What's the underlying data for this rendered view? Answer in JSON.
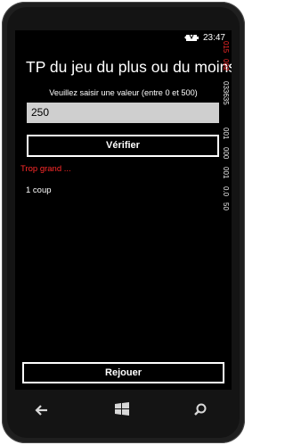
{
  "status_bar": {
    "time": "23:47",
    "icon": "battery-icon"
  },
  "app": {
    "title": "TP du jeu du plus ou du moins",
    "prompt": "Veuillez saisir une valeur (entre 0 et 500)",
    "input_value": "250",
    "verify_label": "Vérifier",
    "result_text": "Trop grand ...",
    "attempts_text": "1 coup",
    "replay_label": "Rejouer"
  },
  "debug_counters": [
    {
      "text": "015",
      "color": "#ff2a2a"
    },
    {
      "text": "002",
      "color": "#ff2a2a"
    },
    {
      "text": "033635",
      "color": "#f0f0f0"
    },
    {
      "text": "001",
      "color": "#f0f0f0"
    },
    {
      "text": "000",
      "color": "#f0f0f0"
    },
    {
      "text": "001",
      "color": "#f0f0f0"
    },
    {
      "text": "0.0",
      "color": "#f0f0f0"
    },
    {
      "text": "50",
      "color": "#f0f0f0"
    }
  ],
  "hardware_buttons": {
    "back": "back-arrow-icon",
    "start": "windows-logo-icon",
    "search": "search-icon"
  }
}
